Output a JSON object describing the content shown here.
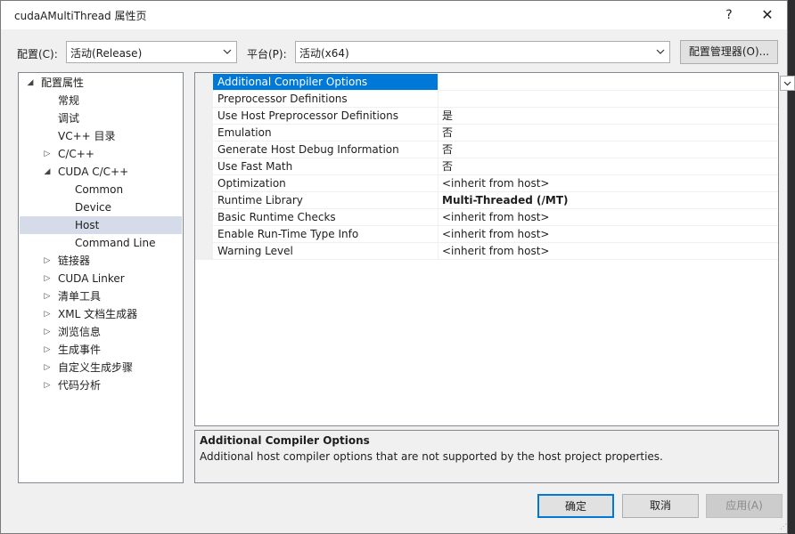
{
  "window": {
    "title": "cudaAMultiThread 属性页",
    "help_label": "?",
    "close_label": "✕"
  },
  "config": {
    "config_label": "配置(C):",
    "config_value": "活动(Release)",
    "platform_label": "平台(P):",
    "platform_value": "活动(x64)",
    "manager_label": "配置管理器(O)..."
  },
  "tree": {
    "items": [
      {
        "label": "配置属性",
        "expander": "◢"
      },
      {
        "label": "常规",
        "expander": ""
      },
      {
        "label": "调试",
        "expander": ""
      },
      {
        "label": "VC++ 目录",
        "expander": ""
      },
      {
        "label": "C/C++",
        "expander": "▷"
      },
      {
        "label": "CUDA C/C++",
        "expander": "◢"
      },
      {
        "label": "Common",
        "expander": ""
      },
      {
        "label": "Device",
        "expander": ""
      },
      {
        "label": "Host",
        "expander": ""
      },
      {
        "label": "Command Line",
        "expander": ""
      },
      {
        "label": "链接器",
        "expander": "▷"
      },
      {
        "label": "CUDA Linker",
        "expander": "▷"
      },
      {
        "label": "清单工具",
        "expander": "▷"
      },
      {
        "label": "XML 文档生成器",
        "expander": "▷"
      },
      {
        "label": "浏览信息",
        "expander": "▷"
      },
      {
        "label": "生成事件",
        "expander": "▷"
      },
      {
        "label": "自定义生成步骤",
        "expander": "▷"
      },
      {
        "label": "代码分析",
        "expander": "▷"
      }
    ],
    "selected": "Host"
  },
  "properties": {
    "rows": [
      {
        "name": "Additional Compiler Options",
        "value": ""
      },
      {
        "name": "Preprocessor Definitions",
        "value": ""
      },
      {
        "name": "Use Host Preprocessor Definitions",
        "value": "是"
      },
      {
        "name": "Emulation",
        "value": "否"
      },
      {
        "name": "Generate Host Debug Information",
        "value": "否"
      },
      {
        "name": "Use Fast Math",
        "value": "否"
      },
      {
        "name": "Optimization",
        "value": "<inherit from host>"
      },
      {
        "name": "Runtime Library",
        "value": "Multi-Threaded (/MT)"
      },
      {
        "name": "Basic Runtime Checks",
        "value": "<inherit from host>"
      },
      {
        "name": "Enable Run-Time Type Info",
        "value": "<inherit from host>"
      },
      {
        "name": "Warning Level",
        "value": "<inherit from host>"
      }
    ],
    "selected": "Additional Compiler Options"
  },
  "description": {
    "title": "Additional Compiler Options",
    "text": "Additional host compiler options that are not supported by the host project properties."
  },
  "buttons": {
    "ok": "确定",
    "cancel": "取消",
    "apply": "应用(A)"
  },
  "colors": {
    "selection": "#0078d7",
    "tree_selection": "#d6dbe9"
  }
}
